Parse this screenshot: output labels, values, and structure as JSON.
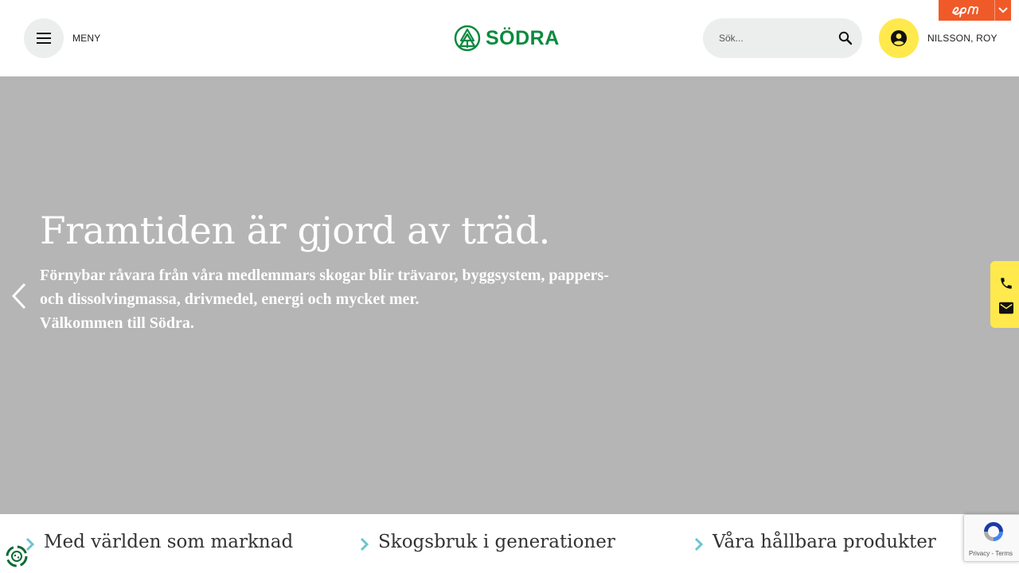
{
  "header": {
    "menu_label": "MENY",
    "logo_text": "SÖDRA",
    "search_placeholder": "Sök...",
    "user_name": "NILSSON, ROY",
    "icons": {
      "menu": "hamburger-icon",
      "search": "search-icon",
      "user": "user-circle-icon",
      "editor": "episerver-logo",
      "editor_toggle": "chevron-down-icon"
    }
  },
  "hero": {
    "title": "Framtiden är gjord av träd.",
    "body_line1": "Förnybar råvara från våra medlemmars skogar blir trävaror, byggsystem, pappers-",
    "body_line2": "och dissolvingmassa, drivmedel, energi och mycket mer.",
    "body_line3": "Välkommen till Södra.",
    "background_color": "#b5b5b5"
  },
  "contact": {
    "icons": [
      "phone-icon",
      "mail-icon"
    ],
    "color": "#ffe94d"
  },
  "features": [
    {
      "title": "Med världen som marknad"
    },
    {
      "title": "Skogsbruk i generationer"
    },
    {
      "title": "Våra hållbara produkter"
    }
  ],
  "recaptcha": {
    "privacy": "Privacy",
    "separator": "-",
    "terms": "Terms"
  },
  "colors": {
    "brand_green": "#0b8a3e",
    "accent_yellow": "#ffe94d",
    "editor_orange": "#f05a28",
    "chevron_teal": "#6cc5d1"
  }
}
